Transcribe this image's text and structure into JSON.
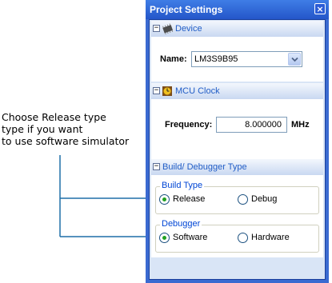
{
  "annotation": {
    "lines": [
      "Choose Release type",
      "type if you want",
      "to use software simulator"
    ]
  },
  "panel": {
    "title": "Project Settings",
    "close_glyph": "×"
  },
  "sections": {
    "device": {
      "toggle": "⊟",
      "icon": "chip-icon",
      "label": "Device",
      "name_label": "Name:",
      "name_value": "LM3S9B95"
    },
    "mcu_clock": {
      "toggle": "⊟",
      "icon": "clock-icon",
      "label": "MCU Clock",
      "frequency_label": "Frequency:",
      "frequency_value": "8.000000",
      "frequency_unit": "MHz"
    },
    "build": {
      "toggle": "⊟",
      "label": "Build/ Debugger Type",
      "build_type": {
        "title": "Build Type",
        "options": [
          "Release",
          "Debug"
        ],
        "selected": "Release"
      },
      "debugger": {
        "title": "Debugger",
        "options": [
          "Software",
          "Hardware"
        ],
        "selected": "Software"
      }
    }
  },
  "colors": {
    "panel_frame": "#3a6ad1",
    "content_bg": "#d9e5f6",
    "header_text": "#215dc6",
    "group_title": "#0046d5",
    "radio_dot": "#21a121",
    "connector": "#1e6fa8"
  }
}
